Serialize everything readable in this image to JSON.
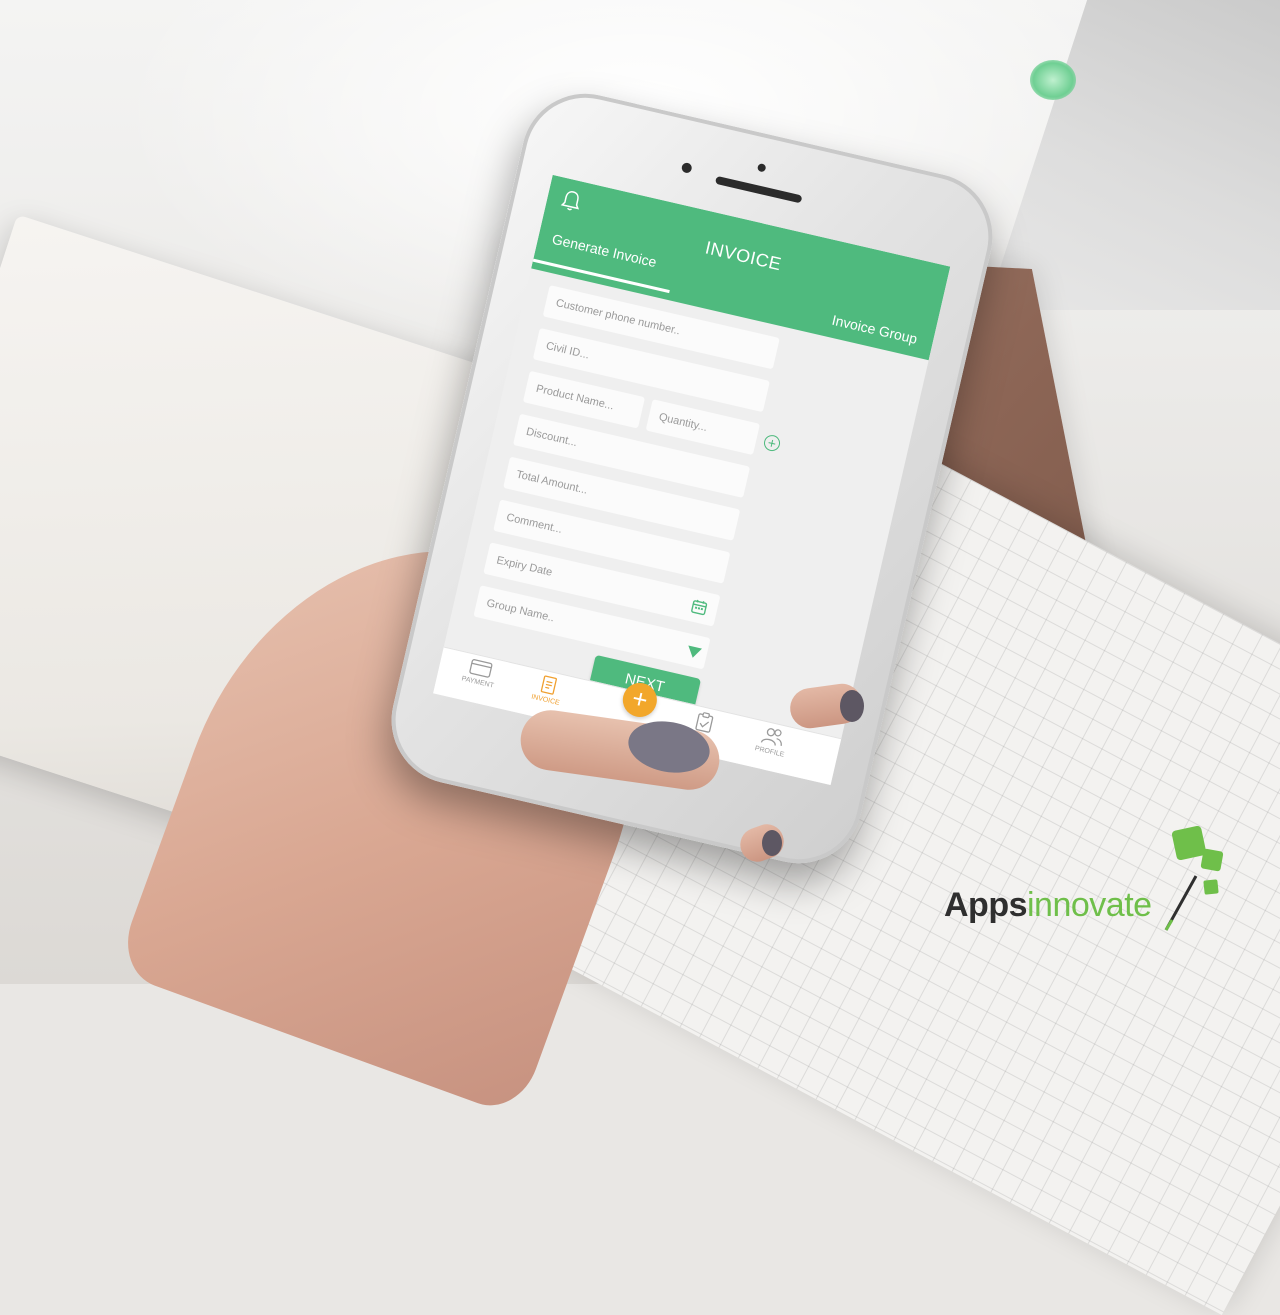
{
  "app": {
    "title": "INVOICE",
    "tabs": [
      {
        "label": "Generate Invoice",
        "active": true
      },
      {
        "label": "Invoice Group",
        "active": false
      }
    ],
    "accent_color": "#4fba7e",
    "fab_color": "#f2a72b"
  },
  "form": {
    "customer_phone": {
      "placeholder": "Customer phone number.."
    },
    "civil_id": {
      "placeholder": "Civil ID..."
    },
    "product_name": {
      "placeholder": "Product Name..."
    },
    "quantity": {
      "placeholder": "Quantity..."
    },
    "discount": {
      "placeholder": "Discount..."
    },
    "total_amount": {
      "placeholder": "Total Amount..."
    },
    "comment": {
      "placeholder": "Comment..."
    },
    "expiry_date": {
      "placeholder": "Expiry Date"
    },
    "group_name": {
      "placeholder": "Group Name.."
    },
    "next_label": "NEXT"
  },
  "icons": {
    "bell": "bell-icon",
    "add_product": "plus-circle-icon",
    "calendar": "calendar-icon",
    "dropdown": "triangle-down-icon"
  },
  "bottom_nav": [
    {
      "label": "PAYMENT",
      "icon": "card-icon",
      "active": false
    },
    {
      "label": "INVOICE",
      "icon": "invoice-icon",
      "active": true
    },
    {
      "label": "",
      "icon": "plus-icon",
      "active": false
    },
    {
      "label": "",
      "icon": "clipboard-icon",
      "active": false
    },
    {
      "label": "PROFILE",
      "icon": "users-icon",
      "active": false
    }
  ],
  "branding": {
    "logo_part1": "Apps",
    "logo_part2": "innovate"
  }
}
